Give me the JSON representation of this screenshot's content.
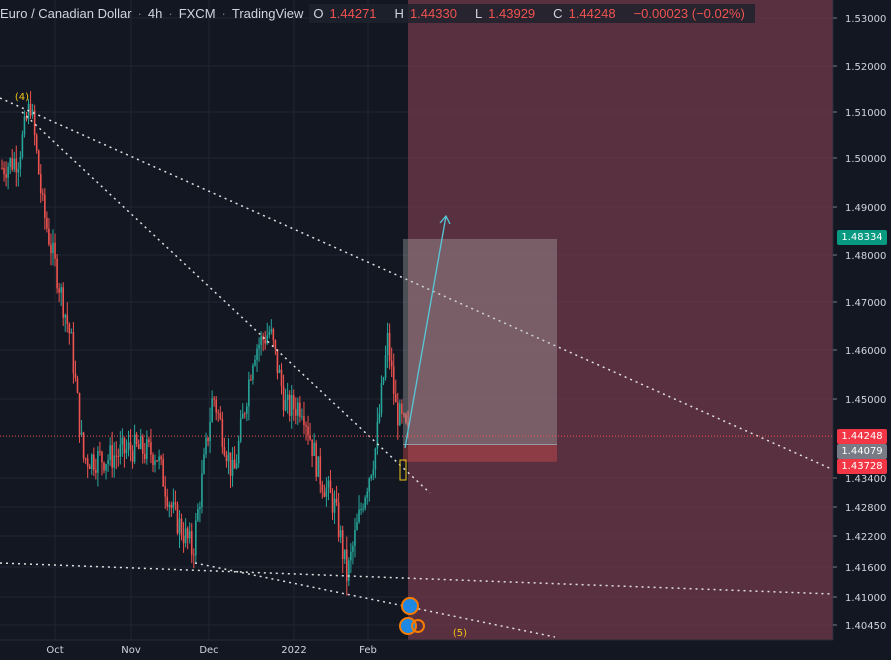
{
  "header": {
    "symbol": "Euro / Canadian Dollar",
    "interval": "4h",
    "exchange": "FXCM",
    "platform": "TradingView",
    "ohlc": [
      {
        "k": "O",
        "v": "1.44271"
      },
      {
        "k": "H",
        "v": "1.44330"
      },
      {
        "k": "L",
        "v": "1.43929"
      },
      {
        "k": "C",
        "v": "1.44248"
      }
    ],
    "change": "−0.00023 (−0.02%)"
  },
  "tags": {
    "target": "1.48334",
    "last": "1.44248",
    "entry": "1.44079",
    "stop": "1.43728"
  },
  "wave_labels": {
    "w4": "(4)",
    "w5": "(5)"
  },
  "colors": {
    "background": "#131722",
    "up": "#26a69a",
    "down": "#ef5350",
    "stop_zone": "rgba(239,83,80,0.35)",
    "profit_zone": "rgba(180,180,180,0.35)",
    "target_tag": "#089981",
    "last_tag": "#f23645",
    "entry_tag": "#787b86",
    "wave_label": "#f0c419"
  },
  "chart_data": {
    "type": "candlestick",
    "y_ticks": [
      1.53,
      1.52,
      1.51,
      1.5,
      1.49,
      1.48,
      1.47,
      1.46,
      1.45,
      1.434,
      1.428,
      1.422,
      1.416,
      1.41,
      1.4045
    ],
    "y_tick_labels": [
      "1.53000",
      "1.52000",
      "1.51000",
      "1.50000",
      "1.49000",
      "1.48000",
      "1.47000",
      "1.46000",
      "1.45000",
      "1.43400",
      "1.42800",
      "1.42200",
      "1.41600",
      "1.41000",
      "1.40450"
    ],
    "x_ticks": [
      "Oct",
      "Nov",
      "Dec",
      "2022",
      "Feb"
    ],
    "price_path": [
      {
        "t": 0,
        "p": 1.498
      },
      {
        "t": 0.04,
        "p": 1.5
      },
      {
        "t": 0.07,
        "p": 1.512
      },
      {
        "t": 0.1,
        "p": 1.49
      },
      {
        "t": 0.13,
        "p": 1.478
      },
      {
        "t": 0.17,
        "p": 1.462
      },
      {
        "t": 0.2,
        "p": 1.438
      },
      {
        "t": 0.26,
        "p": 1.438
      },
      {
        "t": 0.32,
        "p": 1.44
      },
      {
        "t": 0.38,
        "p": 1.439
      },
      {
        "t": 0.42,
        "p": 1.427
      },
      {
        "t": 0.47,
        "p": 1.419
      },
      {
        "t": 0.52,
        "p": 1.451
      },
      {
        "t": 0.57,
        "p": 1.434
      },
      {
        "t": 0.62,
        "p": 1.46
      },
      {
        "t": 0.66,
        "p": 1.464
      },
      {
        "t": 0.7,
        "p": 1.448
      },
      {
        "t": 0.74,
        "p": 1.449
      },
      {
        "t": 0.78,
        "p": 1.435
      },
      {
        "t": 0.82,
        "p": 1.428
      },
      {
        "t": 0.85,
        "p": 1.414
      },
      {
        "t": 0.89,
        "p": 1.43
      },
      {
        "t": 0.92,
        "p": 1.44
      },
      {
        "t": 0.95,
        "p": 1.462
      },
      {
        "t": 0.97,
        "p": 1.448
      },
      {
        "t": 1.0,
        "p": 1.4425
      }
    ],
    "position": {
      "entry": 1.44079,
      "stop": 1.43728,
      "target": 1.48334
    }
  }
}
